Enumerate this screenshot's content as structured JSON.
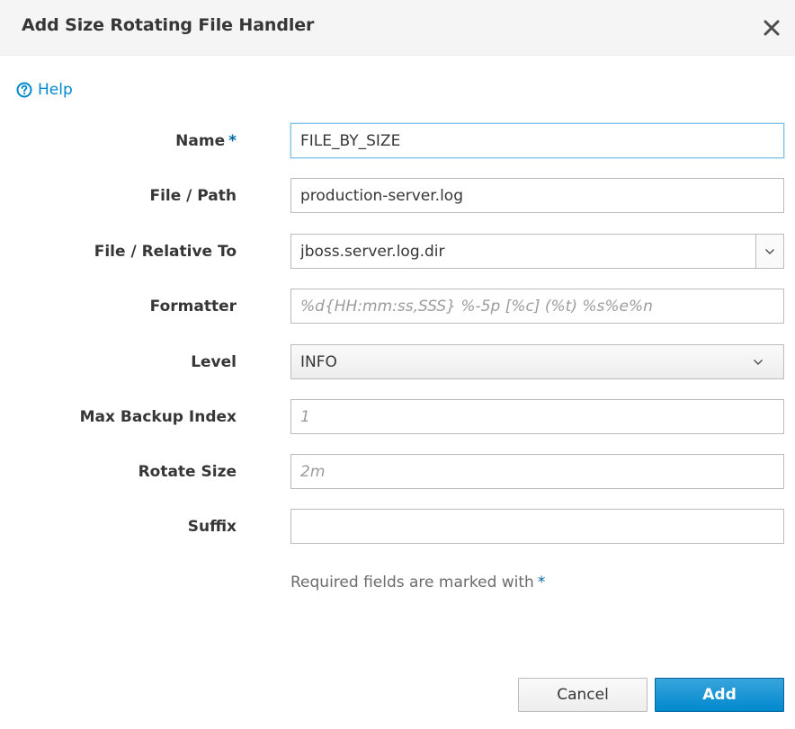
{
  "dialog": {
    "title": "Add Size Rotating File Handler",
    "close_icon": "close-icon"
  },
  "help": {
    "label": "Help",
    "icon": "question-circle-icon"
  },
  "fields": {
    "name": {
      "label": "Name",
      "required_mark": "*",
      "value": "FILE_BY_SIZE"
    },
    "file_path": {
      "label": "File / Path",
      "value": "production-server.log"
    },
    "file_relative_to": {
      "label": "File / Relative To",
      "value": "jboss.server.log.dir",
      "dropdown_icon": "chevron-down-icon"
    },
    "formatter": {
      "label": "Formatter",
      "placeholder": "%d{HH:mm:ss,SSS} %-5p [%c] (%t) %s%e%n"
    },
    "level": {
      "label": "Level",
      "selected": "INFO",
      "dropdown_icon": "chevron-down-icon"
    },
    "max_backup_index": {
      "label": "Max Backup Index",
      "placeholder": "1"
    },
    "rotate_size": {
      "label": "Rotate Size",
      "placeholder": "2m"
    },
    "suffix": {
      "label": "Suffix",
      "value": ""
    }
  },
  "required_note": {
    "text": "Required fields are marked with",
    "mark": "*"
  },
  "buttons": {
    "cancel": "Cancel",
    "add": "Add"
  },
  "colors": {
    "header_bg": "#f5f5f5",
    "link": "#0088ce",
    "required_mark": "#0069a8",
    "primary": "#0088ce",
    "focus_border": "#7dc3e8"
  }
}
